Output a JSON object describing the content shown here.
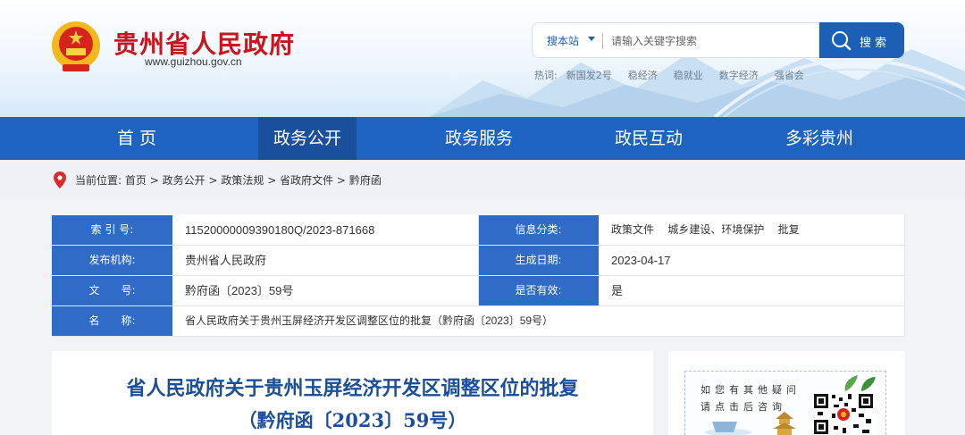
{
  "site": {
    "title": "贵州省人民政府",
    "url": "www.guizhou.gov.cn"
  },
  "search": {
    "scope": "搜本站",
    "placeholder": "请输入关键字搜索",
    "button_label": "搜索"
  },
  "hot_words": {
    "label": "热词:",
    "items": [
      "新国发2号",
      "稳经济",
      "稳就业",
      "数字经济",
      "强省会"
    ]
  },
  "nav": {
    "items": [
      "首 页",
      "政务公开",
      "政务服务",
      "政民互动",
      "多彩贵州"
    ],
    "active_index": 1
  },
  "breadcrumb": {
    "prefix": "当前位置:",
    "items": [
      "首页",
      "政务公开",
      "政策法规",
      "省政府文件",
      "黔府函"
    ],
    "separator": ">"
  },
  "info": {
    "index_label": "索 引 号:",
    "index_value": "11520000009390180Q/2023-871668",
    "category_label": "信息分类:",
    "category_value": "政策文件　 城乡建设、环境保护　 批复",
    "org_label": "发布机构:",
    "org_value": "贵州省人民政府",
    "date_label": "生成日期:",
    "date_value": "2023-04-17",
    "docno_label": "文　　号:",
    "docno_value": "黔府函〔2023〕59号",
    "valid_label": "是否有效:",
    "valid_value": "是",
    "name_label": "名　　称:",
    "name_value": "省人民政府关于贵州玉屏经济开发区调整区位的批复（黔府函〔2023〕59号）"
  },
  "article": {
    "title_line1": "省人民政府关于贵州玉屏经济开发区调整区位的批复",
    "title_line2": "（黔府函〔2023〕59号）"
  },
  "sidebar": {
    "qa_line1": "如您有其他疑问",
    "qa_line2": "请点击后咨询"
  },
  "colors": {
    "brand_red": "#c8161d",
    "nav_blue": "#1f63c0",
    "nav_active": "#1a4f9e",
    "label_blue": "#2f6bc7",
    "title_blue": "#1b4f99"
  }
}
